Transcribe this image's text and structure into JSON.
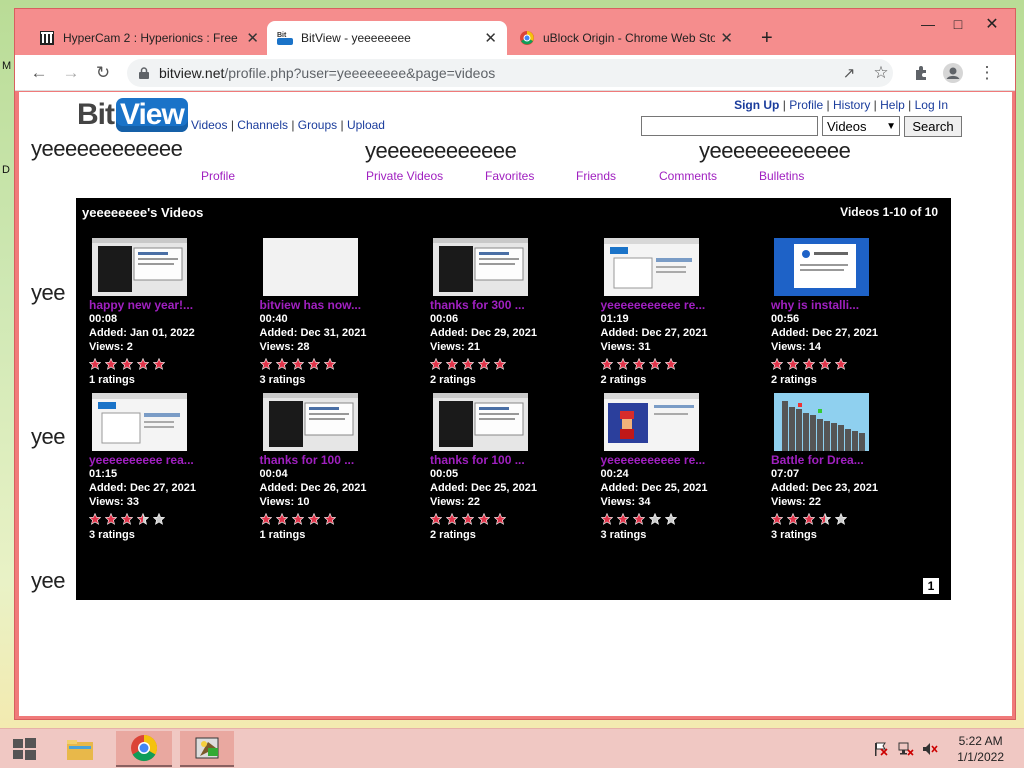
{
  "desktop": {
    "left_chars": [
      "M",
      "D"
    ]
  },
  "browser": {
    "tabs": [
      {
        "title": "HyperCam 2 : Hyperionics : Free",
        "icon": "hypercam-favicon"
      },
      {
        "title": "BitView - yeeeeeeee",
        "icon": "bitview-favicon",
        "active": true
      },
      {
        "title": "uBlock Origin - Chrome Web Stor",
        "icon": "chrome-webstore-favicon"
      }
    ],
    "new_tab_label": "+",
    "url_host": "bitview.net",
    "url_path": "/profile.php?user=yeeeeeeee&page=videos"
  },
  "site": {
    "logo_bit": "Bit",
    "logo_view": "View",
    "nav": [
      "Videos",
      "Channels",
      "Groups",
      "Upload"
    ],
    "account": [
      "Sign Up",
      "Profile",
      "History",
      "Help",
      "Log In"
    ],
    "search": {
      "value": "",
      "category": "Videos",
      "button": "Search"
    },
    "big_names": [
      "yeeeeeeeeeeee",
      "yeeeeeeeeeeee",
      "yeeeeeeeeeeee",
      "yee",
      "yee",
      "yee"
    ],
    "profile_tabs": [
      "Profile",
      "Private Videos",
      "Favorites",
      "Friends",
      "Comments",
      "Bulletins"
    ]
  },
  "videos_box": {
    "title": "yeeeeeeee's Videos",
    "count": "Videos 1-10 of 10",
    "page": "1",
    "items": [
      {
        "title": "happy new year!...",
        "duration": "00:08",
        "added": "Added: Jan 01, 2022",
        "views": "Views: 2",
        "rating": 5,
        "ratings": "1 ratings",
        "thumb": "screen-dark"
      },
      {
        "title": "bitview has now...",
        "duration": "00:40",
        "added": "Added: Dec 31, 2021",
        "views": "Views: 28",
        "rating": 5,
        "ratings": "3 ratings",
        "thumb": "blank"
      },
      {
        "title": "thanks for 300 ...",
        "duration": "00:06",
        "added": "Added: Dec 29, 2021",
        "views": "Views: 21",
        "rating": 5,
        "ratings": "2 ratings",
        "thumb": "screen-dark"
      },
      {
        "title": "yeeeeeeeeeee re...",
        "duration": "01:19",
        "added": "Added: Dec 27, 2021",
        "views": "Views: 31",
        "rating": 5,
        "ratings": "2 ratings",
        "thumb": "screen-light"
      },
      {
        "title": "why is installi...",
        "duration": "00:56",
        "added": "Added: Dec 27, 2021",
        "views": "Views: 14",
        "rating": 5,
        "ratings": "2 ratings",
        "thumb": "screen-blue"
      },
      {
        "title": "yeeeeeeeeee rea...",
        "duration": "01:15",
        "added": "Added: Dec 27, 2021",
        "views": "Views: 33",
        "rating": 3.5,
        "ratings": "3 ratings",
        "thumb": "screen-light"
      },
      {
        "title": "thanks for 100 ...",
        "duration": "00:04",
        "added": "Added: Dec 26, 2021",
        "views": "Views: 10",
        "rating": 5,
        "ratings": "1 ratings",
        "thumb": "screen-dark"
      },
      {
        "title": "thanks for 100 ...",
        "duration": "00:05",
        "added": "Added: Dec 25, 2021",
        "views": "Views: 22",
        "rating": 5,
        "ratings": "2 ratings",
        "thumb": "screen-dark"
      },
      {
        "title": "yeeeeeeeeeee re...",
        "duration": "00:24",
        "added": "Added: Dec 25, 2021",
        "views": "Views: 34",
        "rating": 3,
        "ratings": "3 ratings",
        "thumb": "screen-mario"
      },
      {
        "title": "Battle for Drea...",
        "duration": "07:07",
        "added": "Added: Dec 23, 2021",
        "views": "Views: 22",
        "rating": 3.5,
        "ratings": "3 ratings",
        "thumb": "chart-bars"
      }
    ]
  },
  "taskbar": {
    "apps": [
      "start-button",
      "file-explorer",
      "chrome",
      "hypercam"
    ],
    "time": "5:22 AM",
    "date": "1/1/2022"
  },
  "colors": {
    "accent_purple": "#a020c0",
    "link_blue": "#1a3c9c",
    "star_red": "#e0344a",
    "star_grey": "#cccccc"
  }
}
